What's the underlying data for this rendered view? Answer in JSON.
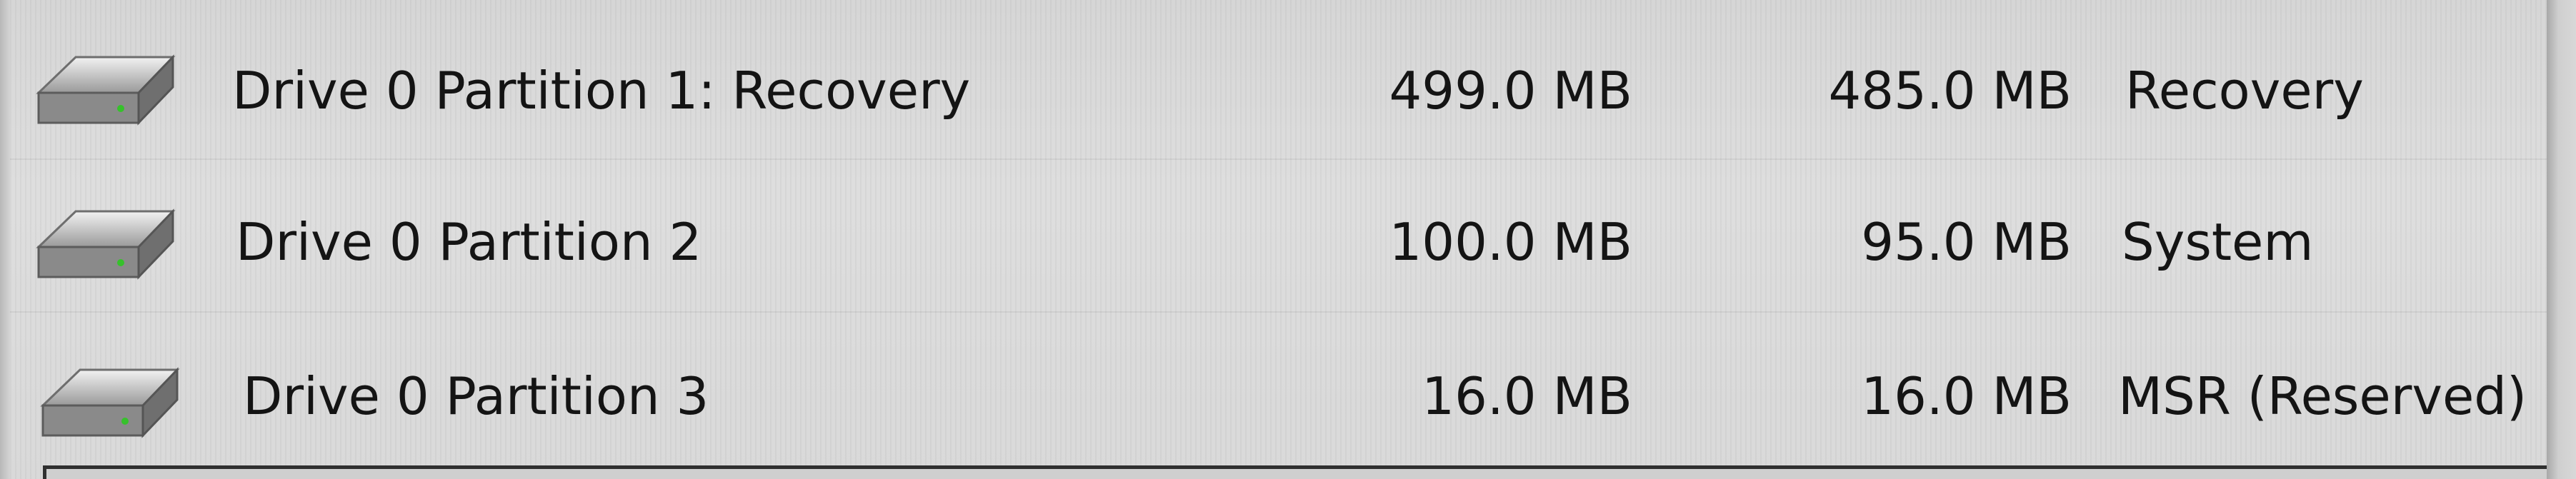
{
  "partitions": [
    {
      "name": "Drive 0 Partition 1: Recovery",
      "total_size": "499.0 MB",
      "free_space": "485.0 MB",
      "type": "Recovery"
    },
    {
      "name": "Drive 0 Partition 2",
      "total_size": "100.0 MB",
      "free_space": "95.0 MB",
      "type": "System"
    },
    {
      "name": "Drive 0 Partition 3",
      "total_size": "16.0 MB",
      "free_space": "16.0 MB",
      "type": "MSR (Reserved)"
    }
  ],
  "icons": {
    "partition": "hard-drive-icon"
  },
  "colors": {
    "background": "#dcdcdc",
    "text": "#141414",
    "drive_led": "#36c12b"
  }
}
